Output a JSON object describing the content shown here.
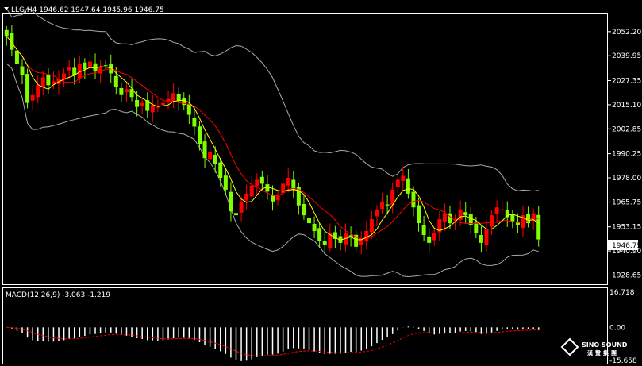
{
  "header": {
    "symbol_line": "LLG,H4  1946.62 1947.64 1945.96 1946.75",
    "macd_line": "MACD(12,26,9) -3.063 -1.219"
  },
  "price_axis": {
    "ticks": [
      "2052.20",
      "2039.95",
      "2027.35",
      "2015.10",
      "2002.85",
      "1990.25",
      "1978.00",
      "1965.75",
      "1953.15",
      "1940.90",
      "1928.65"
    ],
    "current": "1946.75",
    "range": [
      1924,
      2061
    ]
  },
  "macd_axis": {
    "ticks": [
      "16.718",
      "0.00",
      "-15.658"
    ],
    "range": [
      -16.5,
      17.5
    ]
  },
  "watermark": {
    "brand": "SINO SOUND",
    "chinese": "漢聲集團"
  },
  "colors": {
    "background": "#000000",
    "bull_candle": "#ff0000",
    "bear_candle": "#7fff00",
    "ma_fast": "#ffff00",
    "ma_slow": "#ff0000",
    "bollinger": "#a9a9a9",
    "macd_hist": "#ffffff",
    "macd_signal": "#ff0000"
  },
  "chart_data": {
    "type": "candlestick",
    "timeframe": "H4",
    "close_series": [
      2050,
      2043,
      2036,
      2030,
      2016,
      2020,
      2025,
      2029,
      2025,
      2027,
      2028,
      2031,
      2034,
      2030,
      2036,
      2033,
      2037,
      2032,
      2034,
      2035,
      2031,
      2024,
      2020,
      2023,
      2019,
      2014,
      2016,
      2012,
      2015,
      2014,
      2016,
      2018,
      2021,
      2017,
      2015,
      2010,
      2004,
      1995,
      1988,
      1991,
      1985,
      1978,
      1972,
      1961,
      1959,
      1966,
      1970,
      1974,
      1977,
      1975,
      1971,
      1966,
      1969,
      1975,
      1978,
      1972,
      1964,
      1959,
      1955,
      1951,
      1946,
      1944,
      1950,
      1947,
      1945,
      1950,
      1948,
      1943,
      1947,
      1951,
      1957,
      1962,
      1966,
      1964,
      1972,
      1977,
      1979,
      1970,
      1963,
      1955,
      1949,
      1945,
      1950,
      1957,
      1960,
      1955,
      1957,
      1962,
      1959,
      1954,
      1950,
      1945,
      1952,
      1959,
      1963,
      1962,
      1958,
      1956,
      1954,
      1959,
      1955,
      1960,
      1946.75
    ]
  }
}
